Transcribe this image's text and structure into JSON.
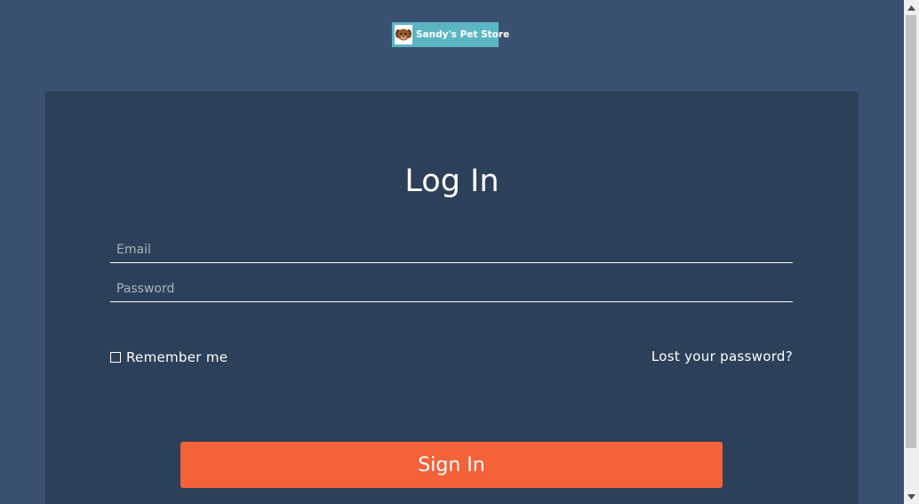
{
  "logo": {
    "text": "Sandy's Pet Store",
    "icon": "dog-face-icon",
    "bg_color": "#5bb6c4"
  },
  "login": {
    "title": "Log In",
    "email_placeholder": "Email",
    "email_value": "",
    "password_placeholder": "Password",
    "password_value": "",
    "remember_label": "Remember me",
    "remember_checked": false,
    "lost_password_label": "Lost your password?",
    "signin_label": "Sign In"
  },
  "colors": {
    "page_bg": "#3a5070",
    "card_bg": "#2d4059",
    "accent": "#f4623a"
  },
  "scrollbar": {
    "up_icon": "scroll-up-arrow-icon",
    "down_icon": "scroll-down-arrow-icon"
  }
}
